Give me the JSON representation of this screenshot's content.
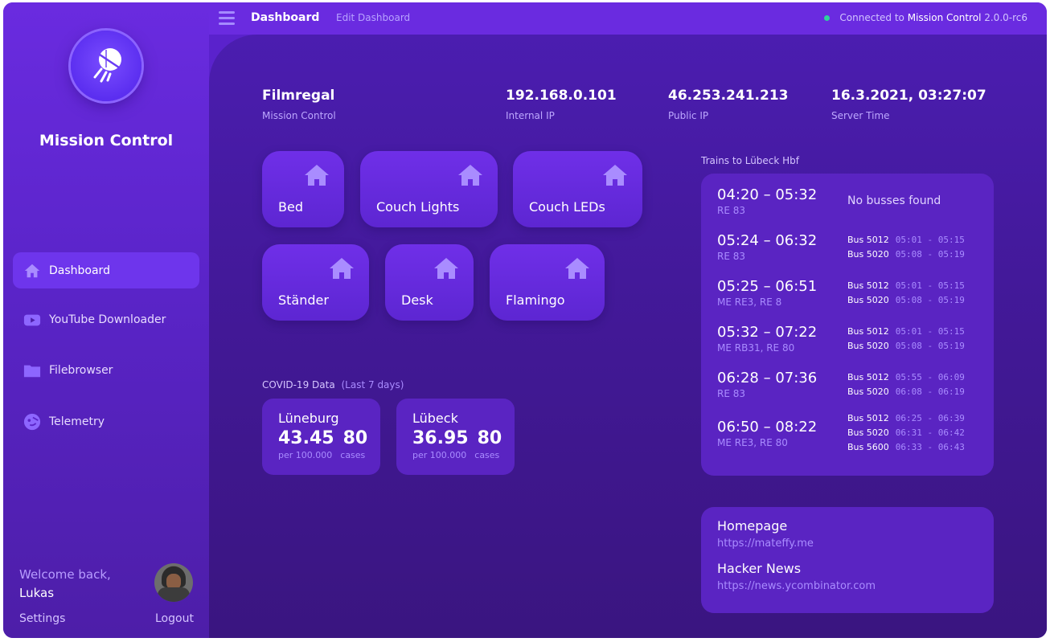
{
  "app": {
    "title": "Mission Control"
  },
  "nav": [
    {
      "label": "Dashboard",
      "icon": "home-icon",
      "active": true
    },
    {
      "label": "YouTube Downloader",
      "icon": "youtube-icon",
      "active": false
    },
    {
      "label": "Filebrowser",
      "icon": "folder-icon",
      "active": false
    },
    {
      "label": "Telemetry",
      "icon": "telemetry-icon",
      "active": false
    }
  ],
  "user": {
    "welcome": "Welcome back,",
    "name": "Lukas",
    "settings": "Settings",
    "logout": "Logout"
  },
  "topbar": {
    "tab_dashboard": "Dashboard",
    "tab_edit": "Edit Dashboard",
    "conn_prefix": "Connected to",
    "conn_name": "Mission Control",
    "conn_version": "2.0.0-rc6",
    "status_color": "#2ed39b"
  },
  "stats": [
    {
      "value": "Filmregal",
      "label": "Mission Control"
    },
    {
      "value": "192.168.0.101",
      "label": "Internal IP"
    },
    {
      "value": "46.253.241.213",
      "label": "Public IP"
    },
    {
      "value": "16.3.2021, 03:27:07",
      "label": "Server Time"
    }
  ],
  "devices": [
    {
      "name": "Bed",
      "icon": "home-icon"
    },
    {
      "name": "Couch Lights",
      "icon": "home-icon"
    },
    {
      "name": "Couch LEDs",
      "icon": "home-icon"
    },
    {
      "name": "Ständer",
      "icon": "home-icon"
    },
    {
      "name": "Desk",
      "icon": "home-icon"
    },
    {
      "name": "Flamingo",
      "icon": "home-icon"
    }
  ],
  "covid": {
    "title": "COVID-19 Data",
    "subtitle": "(Last 7 days)",
    "cards": [
      {
        "city": "Lüneburg",
        "incidence": "43.45",
        "cases": "80",
        "incidence_label": "per 100.000",
        "cases_label": "cases"
      },
      {
        "city": "Lübeck",
        "incidence": "36.95",
        "cases": "80",
        "incidence_label": "per 100.000",
        "cases_label": "cases"
      }
    ]
  },
  "trains": {
    "title": "Trains to Lübeck Hbf",
    "no_bus": "No busses found",
    "rows": [
      {
        "time": "04:20 – 05:32",
        "line": "RE 83",
        "buses": []
      },
      {
        "time": "05:24 – 06:32",
        "line": "RE 83",
        "buses": [
          {
            "name": "Bus 5012",
            "time": "05:01 - 05:15"
          },
          {
            "name": "Bus 5020",
            "time": "05:08 - 05:19"
          }
        ]
      },
      {
        "time": "05:25 – 06:51",
        "line": "ME RE3, RE 8",
        "buses": [
          {
            "name": "Bus 5012",
            "time": "05:01 - 05:15"
          },
          {
            "name": "Bus 5020",
            "time": "05:08 - 05:19"
          }
        ]
      },
      {
        "time": "05:32 – 07:22",
        "line": "ME RB31, RE 80",
        "buses": [
          {
            "name": "Bus 5012",
            "time": "05:01 - 05:15"
          },
          {
            "name": "Bus 5020",
            "time": "05:08 - 05:19"
          }
        ]
      },
      {
        "time": "06:28 – 07:36",
        "line": "RE 83",
        "buses": [
          {
            "name": "Bus 5012",
            "time": "05:55 - 06:09"
          },
          {
            "name": "Bus 5020",
            "time": "06:08 - 06:19"
          }
        ]
      },
      {
        "time": "06:50 – 08:22",
        "line": "ME RE3, RE 80",
        "buses": [
          {
            "name": "Bus 5012",
            "time": "06:25 - 06:39"
          },
          {
            "name": "Bus 5020",
            "time": "06:31 - 06:42"
          },
          {
            "name": "Bus 5600",
            "time": "06:33 - 06:43"
          }
        ]
      }
    ]
  },
  "links": [
    {
      "title": "Homepage",
      "url": "https://mateffy.me"
    },
    {
      "title": "Hacker News",
      "url": "https://news.ycombinator.com"
    }
  ]
}
